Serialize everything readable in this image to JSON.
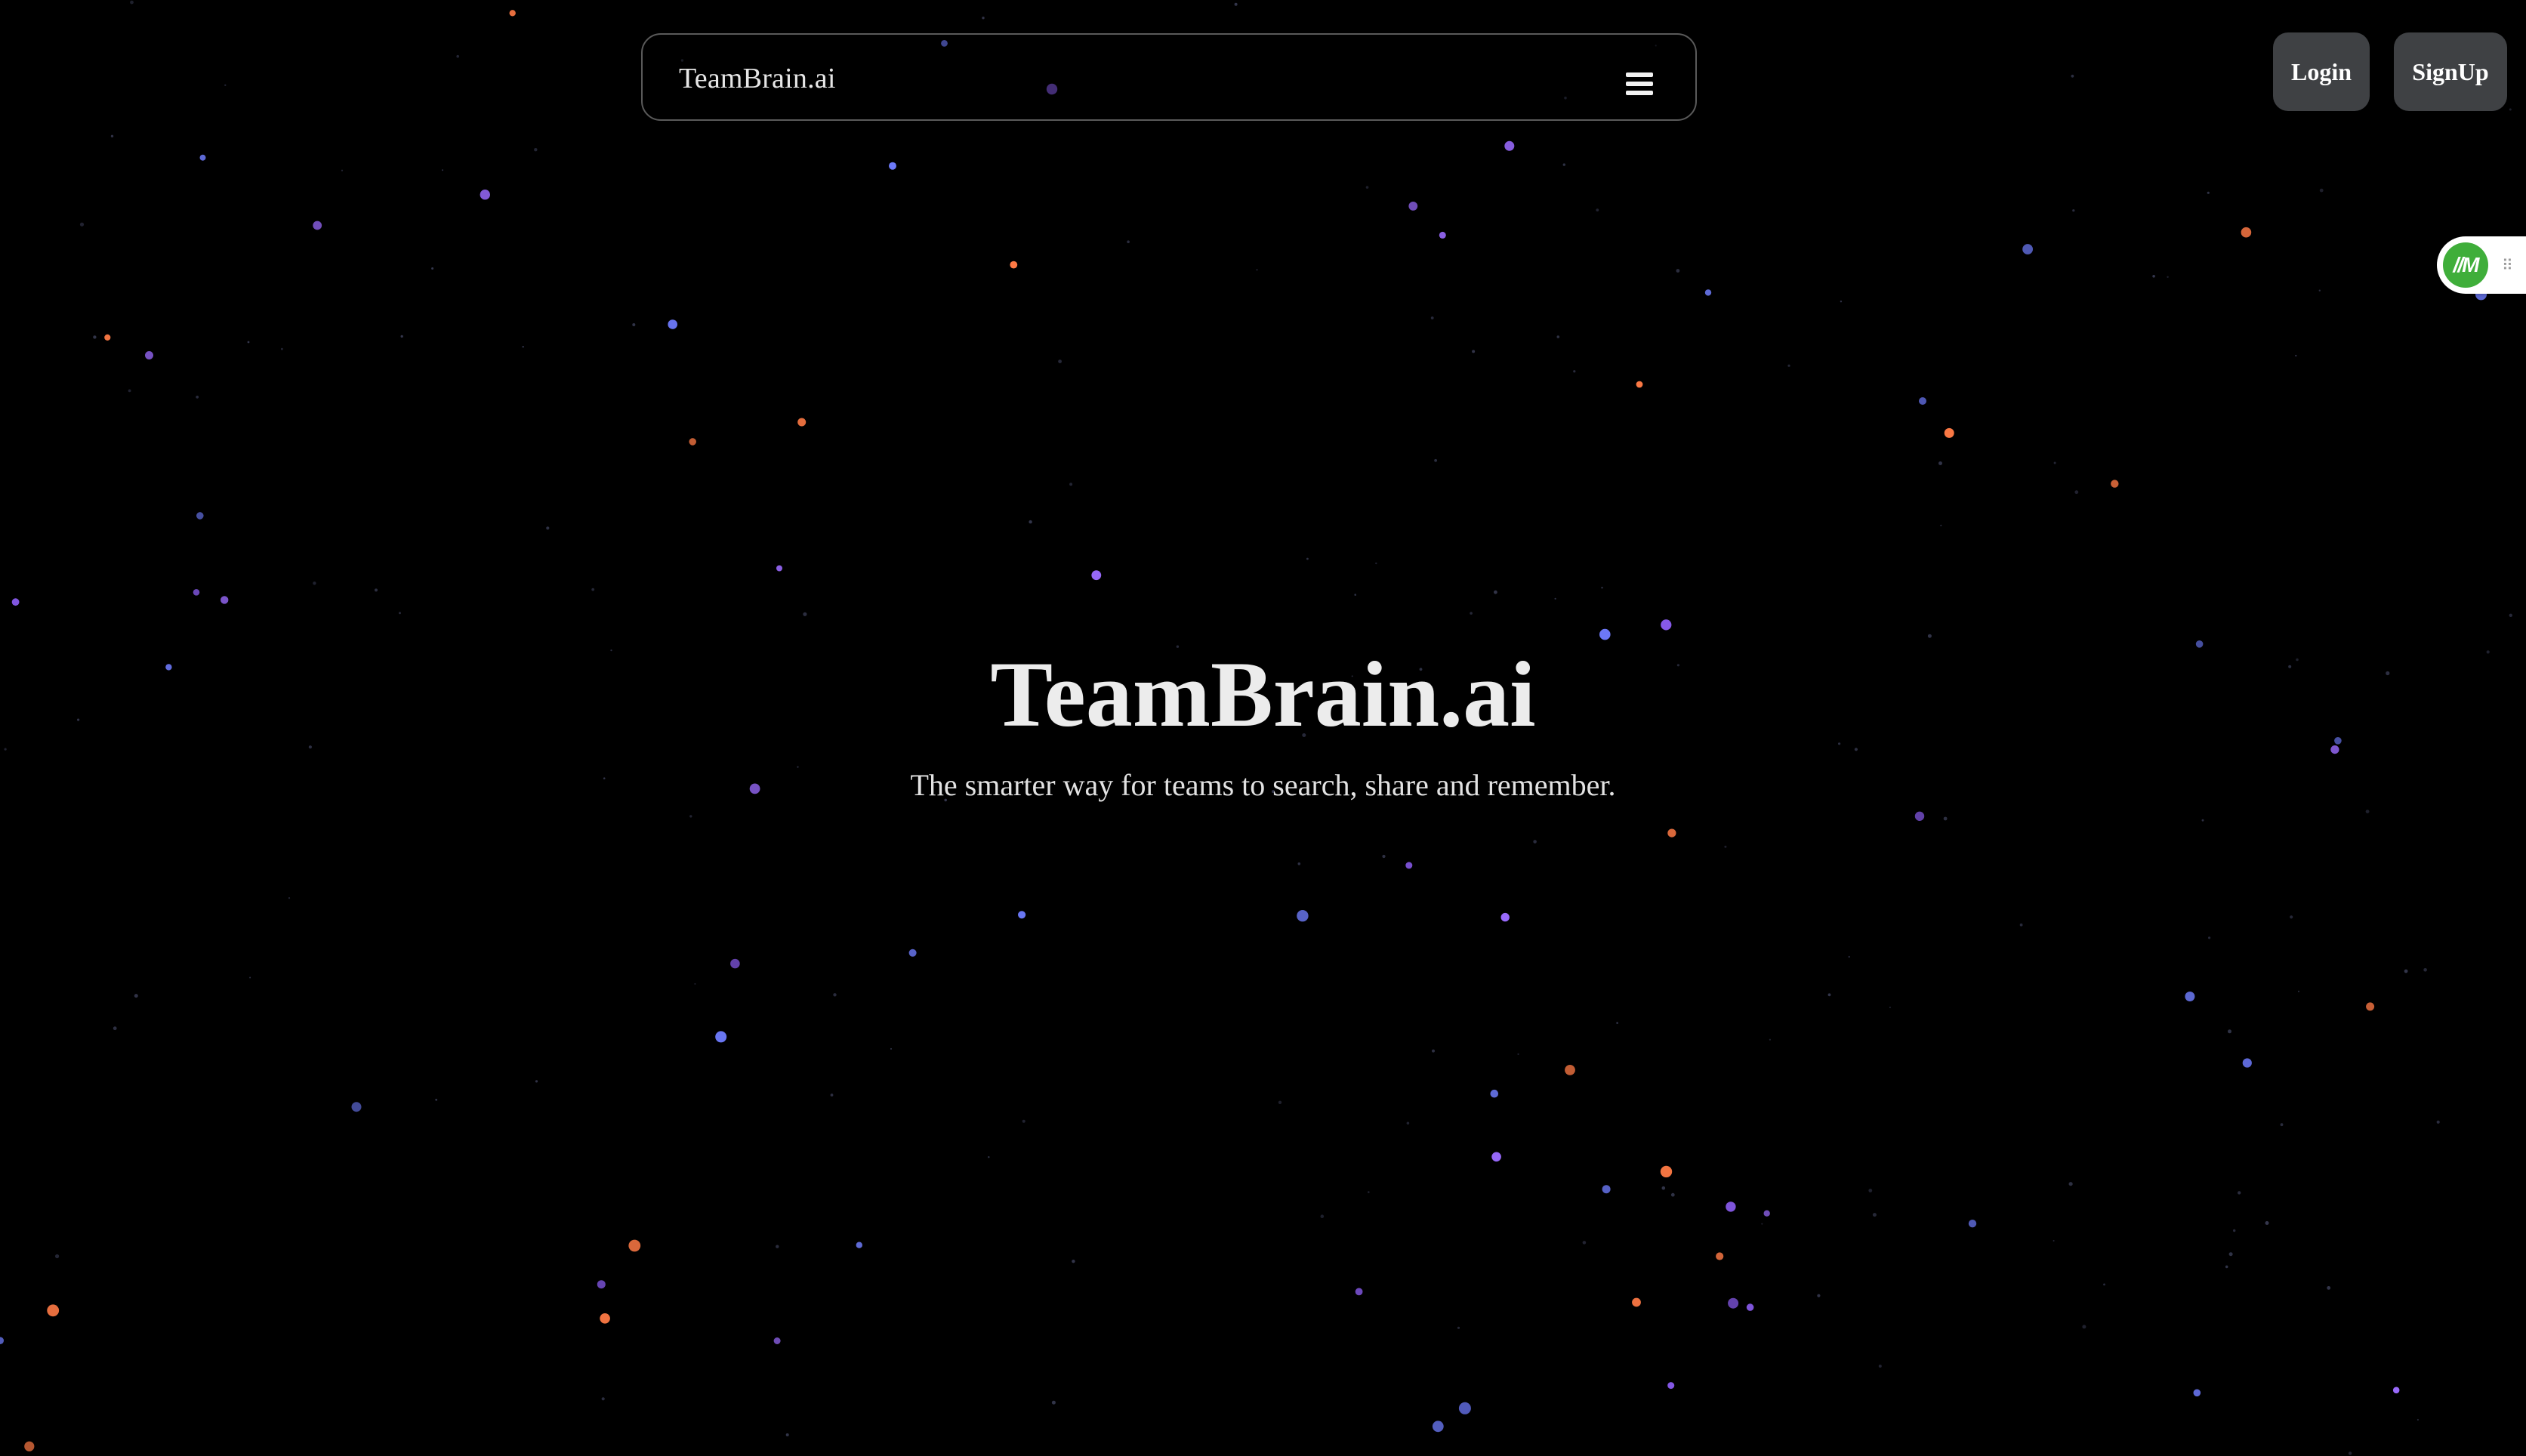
{
  "nav": {
    "brand": "TeamBrain.ai",
    "menu_icon": "hamburger-menu-icon"
  },
  "auth": {
    "login_label": "Login",
    "signup_label": "SignUp"
  },
  "extension_widget": {
    "logo_text": "//M",
    "grip_icon": "drag-grip-icon",
    "logo_color": "#3fae3a"
  },
  "hero": {
    "title": "TeamBrain.ai",
    "subtitle": "The smarter way for teams to search, share and remember."
  },
  "colors": {
    "background": "#000000",
    "button_bg": "#3f4144",
    "star_blue": "#6f7cff",
    "star_violet": "#9b6bff",
    "star_orange": "#ff7a45"
  }
}
